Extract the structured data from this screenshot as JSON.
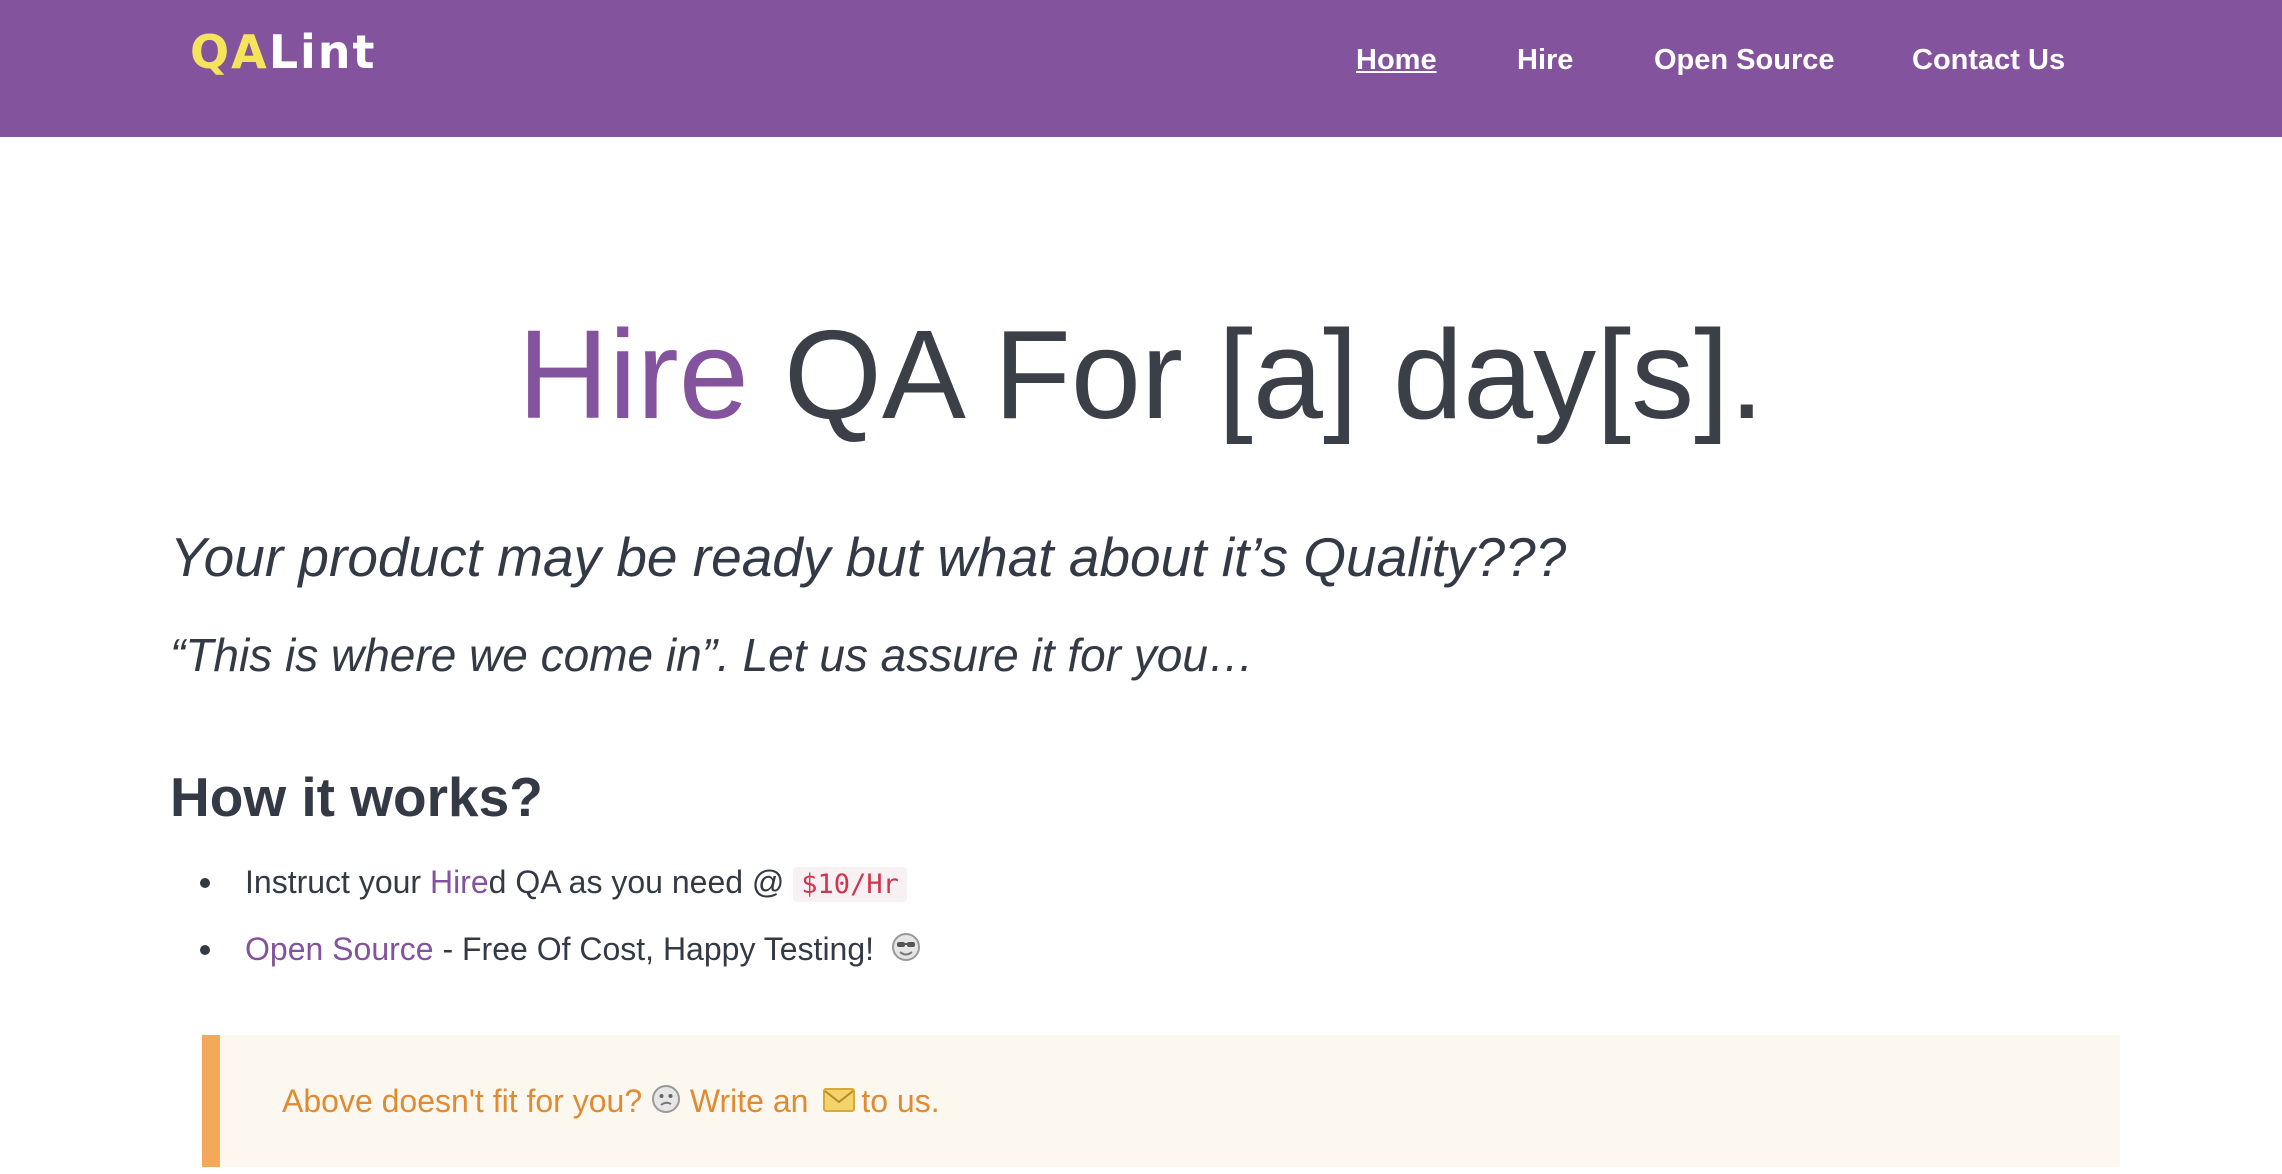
{
  "header": {
    "logo_qa": "QA",
    "logo_lint": "Lint",
    "nav": [
      {
        "label": "Home",
        "active": true
      },
      {
        "label": "Hire",
        "active": false
      },
      {
        "label": "Open Source",
        "active": false
      },
      {
        "label": "Contact Us",
        "active": false
      }
    ]
  },
  "hero": {
    "accent": "Hire",
    "rest": " QA For [a] day[s]."
  },
  "tagline": "Your product may be ready but what about it’s Quality???",
  "quote": "“This is where we come in”. Let us assure it for you…",
  "how": {
    "title": "How it works?",
    "item1": {
      "prefix": "Instruct your ",
      "link": "Hire",
      "mid": "d QA as you need @ ",
      "price": "$10/Hr"
    },
    "item2": {
      "link": "Open Source",
      "text": " - Free Of Cost, Happy Testing!",
      "emoji_icon": "sunglasses-face-icon"
    }
  },
  "notice": {
    "text1": "Above doesn't fit for you?",
    "emoji_icon": "confused-face-icon",
    "text2": " Write an",
    "envelope_icon": "envelope-icon",
    "text3": "to us."
  },
  "colors": {
    "brand_purple": "#84539d",
    "logo_yellow": "#f6e35c",
    "notice_orange": "#e08a32",
    "notice_border": "#f5a75a",
    "code_red": "#d1344f"
  }
}
